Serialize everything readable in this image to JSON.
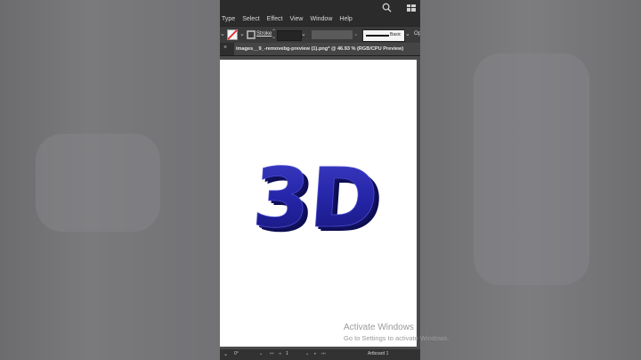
{
  "menu": {
    "items": [
      "Type",
      "Select",
      "Effect",
      "View",
      "Window",
      "Help"
    ]
  },
  "control": {
    "stroke_label": "Stroke",
    "style_label": "Basic",
    "opacity_label": "Op"
  },
  "tab": {
    "title": "images__9_-removebg-preview (1).png* @ 46.93 % (RGB/CPU Preview)"
  },
  "artwork": {
    "text": "3D",
    "color": "#1c1c8c"
  },
  "status": {
    "rotation": "0°",
    "artboard_number": "1",
    "artboard_name": "Artboard 1"
  },
  "watermark": {
    "title": "Activate Windows",
    "subtitle": "Go to Settings to activate Windows."
  }
}
